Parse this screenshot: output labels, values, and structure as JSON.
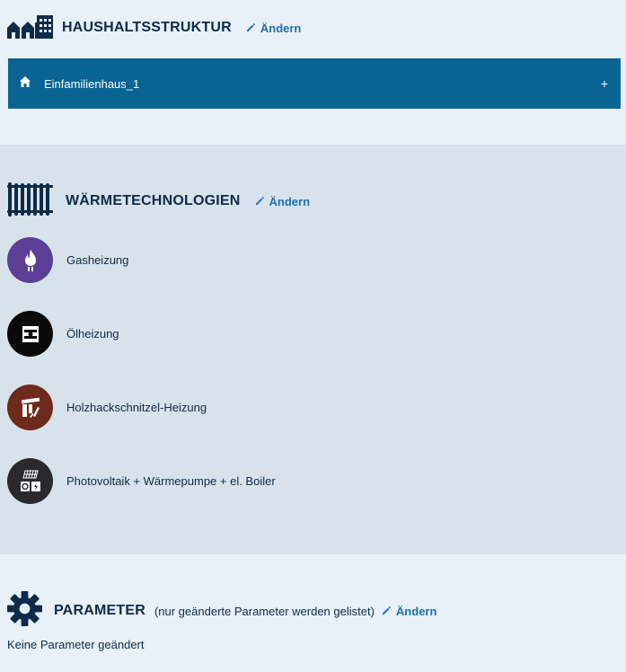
{
  "household": {
    "title": "HAUSHALTSSTRUKTUR",
    "edit_label": "Ändern",
    "icon": "buildings-icon",
    "houses": [
      {
        "label": "Einfamilienhaus_1",
        "expand_label": "+",
        "icon": "home-icon"
      }
    ]
  },
  "heat_tech": {
    "title": "WÄRMETECHNOLOGIEN",
    "edit_label": "Ändern",
    "icon": "radiator-icon",
    "items": [
      {
        "label": "Gasheizung",
        "icon": "gas-flame-icon",
        "color": "#5b3f96"
      },
      {
        "label": "Ölheizung",
        "icon": "oil-tank-icon",
        "color": "#0a0a0a"
      },
      {
        "label": "Holzhackschnitzel-Heizung",
        "icon": "wood-chips-icon",
        "color": "#6e2a1a"
      },
      {
        "label": "Photovoltaik + Wärmepumpe + el. Boiler",
        "icon": "solar-heatpump-icon",
        "color": "#2a2a2e"
      }
    ]
  },
  "params": {
    "title": "PARAMETER",
    "note": "(nur geänderte Parameter werden gelistet)",
    "edit_label": "Ändern",
    "icon": "gear-icon",
    "empty_text": "Keine Parameter geändert"
  },
  "colors": {
    "accent": "#1f6fb0",
    "house_bar": "#0a6493",
    "title": "#0d2b4a"
  }
}
